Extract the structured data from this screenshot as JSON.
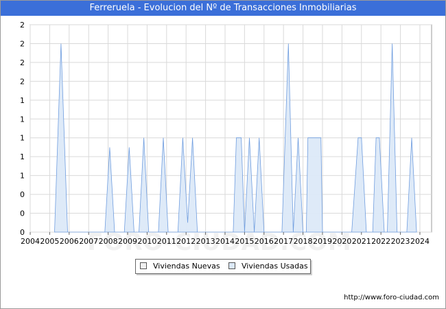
{
  "title": "Ferreruela - Evolucion del Nº de Transacciones Inmobiliarias",
  "footer_url": "http://www.foro-ciudad.com",
  "watermark": "FORO-CIUDAD.COM",
  "colors": {
    "title_bg": "#3b6fd9",
    "usadas_fill": "#dce9f8",
    "usadas_line": "#6f9ddf",
    "nuevas_fill": "#f0f0f0",
    "grid": "#d9d9d9"
  },
  "chart_data": {
    "type": "area",
    "title": "Ferreruela - Evolucion del Nº de Transacciones Inmobiliarias",
    "xlabel": "",
    "ylabel": "",
    "x_ticks": [
      "2004",
      "2005",
      "2006",
      "2007",
      "2008",
      "2009",
      "2010",
      "2011",
      "2012",
      "2013",
      "2014",
      "2015",
      "2016",
      "2017",
      "2018",
      "2019",
      "2020",
      "2021",
      "2022",
      "2023",
      "2024"
    ],
    "y_tick_labels": [
      "0",
      "0",
      "0",
      "1",
      "1",
      "1",
      "1",
      "1",
      "2",
      "2",
      "2",
      "2"
    ],
    "ylim": [
      0,
      2.2
    ],
    "grid": true,
    "legend_position": "bottom",
    "series": [
      {
        "name": "Viviendas Nuevas",
        "color": "#f0f0f0",
        "points": []
      },
      {
        "name": "Viviendas Usadas",
        "color": "#dce9f8",
        "points": [
          [
            2005.25,
            0
          ],
          [
            2005.58,
            2
          ],
          [
            2005.92,
            0
          ],
          [
            2007.83,
            0
          ],
          [
            2008.08,
            0.9
          ],
          [
            2008.33,
            0
          ],
          [
            2008.83,
            0
          ],
          [
            2009.08,
            0.9
          ],
          [
            2009.33,
            0
          ],
          [
            2009.58,
            0
          ],
          [
            2009.83,
            1
          ],
          [
            2010.08,
            0
          ],
          [
            2010.58,
            0
          ],
          [
            2010.83,
            1
          ],
          [
            2011.08,
            0
          ],
          [
            2011.58,
            0
          ],
          [
            2011.83,
            1
          ],
          [
            2012.08,
            0.1
          ],
          [
            2012.33,
            1
          ],
          [
            2012.58,
            0
          ],
          [
            2014.42,
            0
          ],
          [
            2014.58,
            1
          ],
          [
            2014.83,
            1
          ],
          [
            2015.0,
            0
          ],
          [
            2015.25,
            1
          ],
          [
            2015.5,
            0
          ],
          [
            2015.75,
            1
          ],
          [
            2016.0,
            0
          ],
          [
            2016.92,
            0
          ],
          [
            2017.25,
            2
          ],
          [
            2017.5,
            0
          ],
          [
            2017.75,
            1
          ],
          [
            2018.0,
            0
          ],
          [
            2018.17,
            0
          ],
          [
            2018.25,
            1
          ],
          [
            2018.92,
            1
          ],
          [
            2019.0,
            0
          ],
          [
            2020.5,
            0
          ],
          [
            2020.83,
            1
          ],
          [
            2021.0,
            1
          ],
          [
            2021.25,
            0
          ],
          [
            2021.58,
            0
          ],
          [
            2021.75,
            1
          ],
          [
            2021.92,
            1
          ],
          [
            2022.17,
            0
          ],
          [
            2022.33,
            0
          ],
          [
            2022.58,
            2
          ],
          [
            2022.83,
            0
          ],
          [
            2023.33,
            0
          ],
          [
            2023.58,
            1
          ],
          [
            2023.83,
            0
          ]
        ]
      }
    ]
  },
  "legend": {
    "nuevas_label": "Viviendas Nuevas",
    "usadas_label": "Viviendas Usadas"
  }
}
